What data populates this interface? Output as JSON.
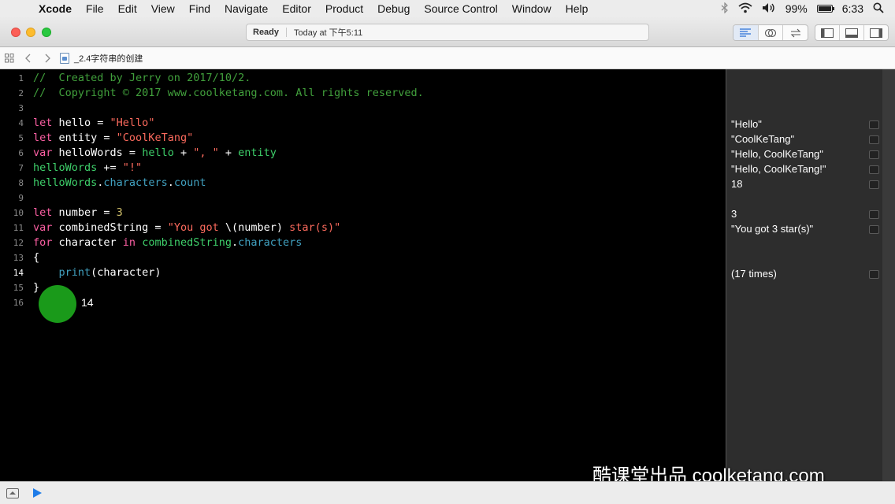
{
  "menubar": {
    "apple_glyph": "",
    "items": [
      "Xcode",
      "File",
      "Edit",
      "View",
      "Find",
      "Navigate",
      "Editor",
      "Product",
      "Debug",
      "Source Control",
      "Window",
      "Help"
    ],
    "battery_percent": "99%",
    "battery_level": 0.99,
    "clock": "6:33",
    "status_icons": [
      "bluetooth-icon",
      "wifi-icon",
      "volume-icon",
      "battery-icon",
      "search-icon"
    ]
  },
  "toolbar": {
    "status": "Ready",
    "timestamp": "Today at 下午5:11"
  },
  "jumpbar": {
    "file_name": "_2.4字符串的创建"
  },
  "editor": {
    "current_line": 14,
    "line_numbers": [
      "1",
      "2",
      "3",
      "4",
      "5",
      "6",
      "7",
      "8",
      "9",
      "10",
      "11",
      "12",
      "13",
      "14",
      "15",
      "16"
    ],
    "lines": [
      [
        [
          "cm",
          "//  Created by Jerry on 2017/10/2."
        ]
      ],
      [
        [
          "cm",
          "//  Copyright © 2017 www.coolketang.com. All rights reserved."
        ]
      ],
      [],
      [
        [
          "kw",
          "let"
        ],
        [
          "plain",
          " hello = "
        ],
        [
          "str",
          "\"Hello\""
        ]
      ],
      [
        [
          "kw",
          "let"
        ],
        [
          "plain",
          " entity = "
        ],
        [
          "str",
          "\"CoolKeTang\""
        ]
      ],
      [
        [
          "kw",
          "var"
        ],
        [
          "plain",
          " helloWords = "
        ],
        [
          "id",
          "hello"
        ],
        [
          "plain",
          " + "
        ],
        [
          "str",
          "\", \""
        ],
        [
          "plain",
          " + "
        ],
        [
          "id",
          "entity"
        ]
      ],
      [
        [
          "id",
          "helloWords"
        ],
        [
          "plain",
          " += "
        ],
        [
          "str",
          "\"!\""
        ]
      ],
      [
        [
          "id",
          "helloWords"
        ],
        [
          "plain",
          "."
        ],
        [
          "sys",
          "characters"
        ],
        [
          "plain",
          "."
        ],
        [
          "sys",
          "count"
        ]
      ],
      [],
      [
        [
          "kw",
          "let"
        ],
        [
          "plain",
          " number = "
        ],
        [
          "num",
          "3"
        ]
      ],
      [
        [
          "kw",
          "var"
        ],
        [
          "plain",
          " combinedString = "
        ],
        [
          "str",
          "\"You got "
        ],
        [
          "plain",
          "\\("
        ],
        [
          "plain",
          "number"
        ],
        [
          "plain",
          ")"
        ],
        [
          "str",
          " star(s)\""
        ]
      ],
      [
        [
          "kw",
          "for"
        ],
        [
          "plain",
          " character "
        ],
        [
          "kw",
          "in"
        ],
        [
          "plain",
          " "
        ],
        [
          "id",
          "combinedString"
        ],
        [
          "plain",
          "."
        ],
        [
          "sys",
          "characters"
        ]
      ],
      [
        [
          "plain",
          "{"
        ]
      ],
      [
        [
          "plain",
          "    "
        ],
        [
          "sys",
          "print"
        ],
        [
          "plain",
          "(character)"
        ]
      ],
      [
        [
          "plain",
          "}"
        ]
      ],
      []
    ],
    "cursor_badge": "14"
  },
  "results": [
    {
      "line": 4,
      "text": "\"Hello\""
    },
    {
      "line": 5,
      "text": "\"CoolKeTang\""
    },
    {
      "line": 6,
      "text": "\"Hello, CoolKeTang\""
    },
    {
      "line": 7,
      "text": "\"Hello, CoolKeTang!\""
    },
    {
      "line": 8,
      "text": "18"
    },
    {
      "line": 10,
      "text": "3"
    },
    {
      "line": 11,
      "text": "\"You got 3 star(s)\""
    },
    {
      "line": 14,
      "text": "(17 times)"
    }
  ],
  "watermark": "酷课堂出品 coolketang.com",
  "colors": {
    "keyword": "#fc5fa3",
    "string": "#fc6a5d",
    "comment": "#41a03c",
    "project_identifier": "#3ecf6a",
    "system_identifier": "#41a1c0",
    "number": "#d0bf69",
    "editor_background": "#000000",
    "results_background": "#2d2d2d"
  }
}
